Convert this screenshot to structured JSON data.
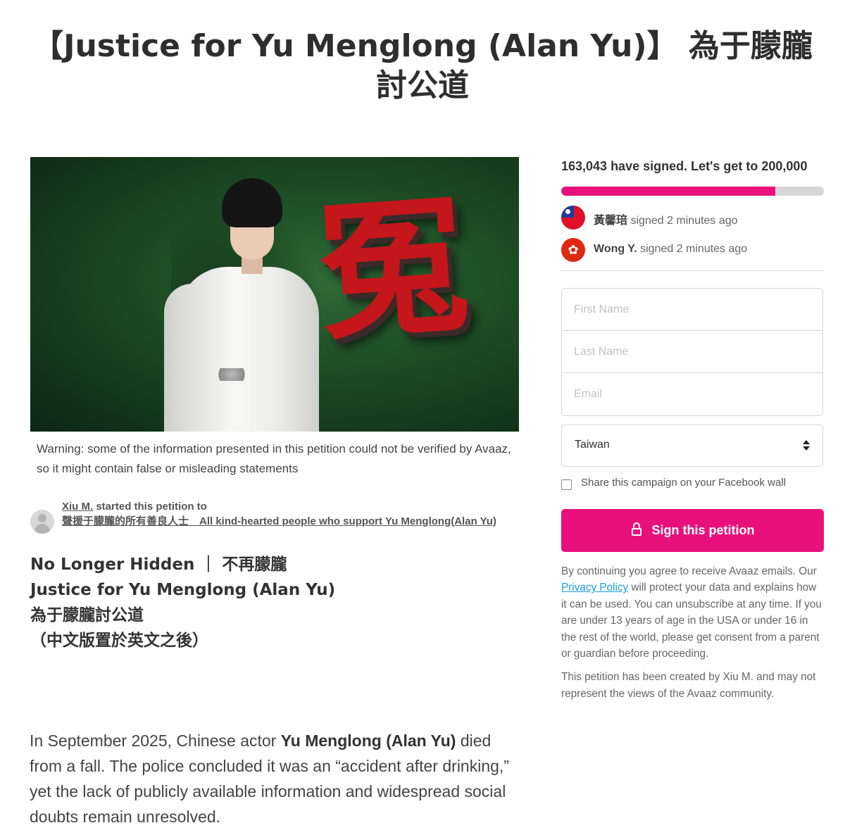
{
  "title": "【Justice for Yu Menglong (Alan Yu)】 為于朦朧討公道",
  "hero": {
    "glyph": "冤"
  },
  "warning": "Warning: some of the information presented in this petition could not be verified by Avaaz, so it might contain false or misleading statements",
  "starter": {
    "name": "Xiu M.",
    "action": "started this petition to",
    "recipient": "聲援于朦朧的所有善良人士　All kind-hearted people who support Yu Menglong(Alan Yu)"
  },
  "subhead": {
    "line1": "No Longer Hidden ｜ 不再朦朧",
    "line2": "Justice for Yu Menglong (Alan Yu)",
    "line3": "為于朦朧討公道",
    "line4": "（中文版置於英文之後）"
  },
  "body": {
    "part1": "In September 2025, Chinese actor ",
    "bold": "Yu Menglong (Alan Yu)",
    "part2": " died from a fall. The police concluded it was an “accident after drinking,” yet the lack of publicly available information and widespread social doubts remain unresolved."
  },
  "sidebar": {
    "signed_text": "163,043 have signed. Let's get to 200,000",
    "signed_count": 163043,
    "goal": 200000,
    "progress_fraction": 0.8152,
    "accent_color": "#e8117b",
    "recent_signers": [
      {
        "name": "黃馨琣",
        "action": "signed 2 minutes ago",
        "flag": "taiwan-flag-icon"
      },
      {
        "name": "Wong Y.",
        "action": "signed 2 minutes ago",
        "flag": "hong-kong-flag-icon"
      }
    ],
    "form": {
      "first_name_placeholder": "First Name",
      "last_name_placeholder": "Last Name",
      "email_placeholder": "Email",
      "country_value": "Taiwan",
      "share_label": "Share this campaign on your Facebook wall",
      "sign_button": "Sign this petition"
    },
    "legal": {
      "before": "By continuing you agree to receive Avaaz emails. Our ",
      "link": "Privacy Policy",
      "after": " will protect your data and explains how it can be used. You can unsubscribe at any time. If you are under 13 years of age in the USA or under 16 in the rest of the world, please get consent from a parent or guardian before proceeding."
    },
    "created_note": "This petition has been created by Xiu M. and may not represent the views of the Avaaz community."
  }
}
